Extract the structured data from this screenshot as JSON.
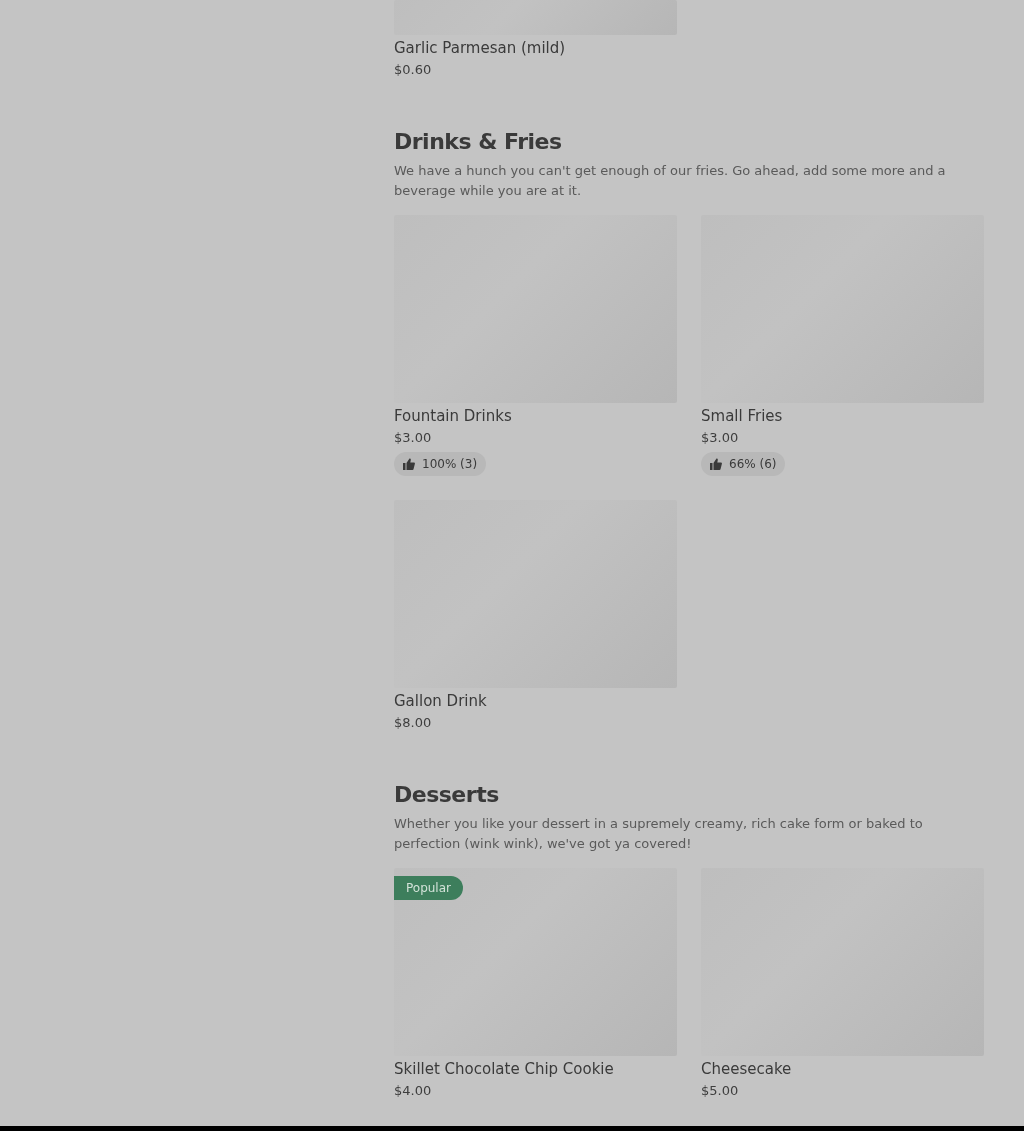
{
  "top_item": {
    "name": "Garlic Parmesan (mild)",
    "price": "$0.60"
  },
  "sections": [
    {
      "title": "Drinks & Fries",
      "description": "We have a hunch you can't get enough of our fries. Go ahead, add some more and a beverage while you are at it.",
      "items": [
        {
          "name": "Fountain Drinks",
          "price": "$3.00",
          "rating": "100% (3)"
        },
        {
          "name": "Small Fries",
          "price": "$3.00",
          "rating": "66% (6)"
        },
        {
          "name": "Gallon Drink",
          "price": "$8.00"
        }
      ]
    },
    {
      "title": "Desserts",
      "description": "Whether you like your dessert in a supremely creamy, rich cake form or baked to perfection (wink wink), we've got ya covered!",
      "items": [
        {
          "name": "Skillet Chocolate Chip Cookie",
          "price": "$4.00",
          "badge": "Popular"
        },
        {
          "name": "Cheesecake",
          "price": "$5.00"
        }
      ]
    }
  ]
}
